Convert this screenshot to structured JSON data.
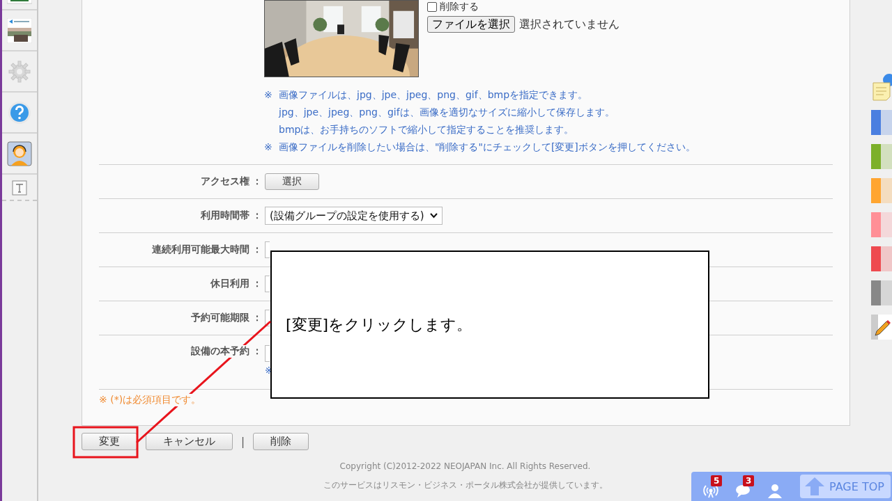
{
  "sidebar": {
    "items": [
      {
        "kind": "logo"
      },
      {
        "kind": "thumbnail"
      },
      {
        "kind": "gear"
      },
      {
        "kind": "help"
      },
      {
        "kind": "operator"
      },
      {
        "kind": "text"
      }
    ]
  },
  "image_section": {
    "delete_checkbox": {
      "label": "削除する",
      "checked": false
    },
    "file_button": "ファイルを選択",
    "file_status": "選択されていません"
  },
  "notes": [
    {
      "mark": "※",
      "text": "画像ファイルは、jpg、jpe、jpeg、png、gif、bmpを指定できます。"
    },
    {
      "text": "jpg、jpe、jpeg、png、gifは、画像を適切なサイズに縮小して保存します。"
    },
    {
      "text": "bmpは、お手持ちのソフトで縮小して指定することを推奨します。"
    },
    {
      "mark": "※",
      "text": "画像ファイルを削除したい場合は、\"削除する\"にチェックして[変更]ボタンを押してください。"
    }
  ],
  "rows": [
    {
      "label": "アクセス権",
      "colon": "：",
      "kind": "button",
      "value": "選択"
    },
    {
      "label": "利用時間帯",
      "colon": "：",
      "kind": "select",
      "value": "(設備グループの設定を使用する)"
    },
    {
      "label": "連続利用可能最大時間",
      "colon": "：",
      "kind": "input"
    },
    {
      "label": "休日利用",
      "colon": "：",
      "kind": "input"
    },
    {
      "label": "予約可能期限",
      "colon": "：",
      "kind": "input"
    },
    {
      "label": "設備の本予約",
      "colon": "：",
      "kind": "input",
      "note": "※"
    }
  ],
  "required_note": "※ (*)は必須項目です。",
  "actions": [
    {
      "kind": "button",
      "label": "変更"
    },
    {
      "kind": "button",
      "label": "キャンセル"
    },
    {
      "kind": "separator",
      "label": "|"
    },
    {
      "kind": "button",
      "label": "削除"
    }
  ],
  "footer": {
    "copyright": "Copyright (C)2012-2022 NEOJAPAN Inc. All Rights Reserved.",
    "provider": "このサービスはリスモン・ビジネス・ポータル株式会社が提供しています。"
  },
  "bottom_bar": {
    "items": [
      {
        "kind": "antenna",
        "badge": "5"
      },
      {
        "kind": "chat",
        "badge": "3"
      },
      {
        "kind": "person"
      }
    ],
    "page_top": "PAGE TOP"
  },
  "palette": [
    {
      "kind": "memo"
    },
    {
      "kind": "tab",
      "color": "#4a7fe0"
    },
    {
      "kind": "tab",
      "color": "#7cb02a"
    },
    {
      "kind": "tab",
      "color": "#ffa530"
    },
    {
      "kind": "tab",
      "color": "#ff8f96"
    },
    {
      "kind": "tab",
      "color": "#ee4a50"
    },
    {
      "kind": "tab",
      "color": "#888888"
    },
    {
      "kind": "pencil"
    }
  ],
  "callout": {
    "text": "[変更]をクリックします。"
  }
}
